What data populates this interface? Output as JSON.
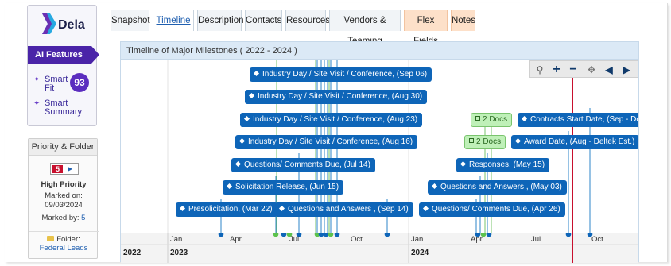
{
  "brand": {
    "logo_text": "Dela",
    "ai_tab": "AI Features",
    "smart_fit_label": "Smart Fit",
    "smart_fit_score": "93",
    "smart_summary_label": "Smart Summary"
  },
  "priority": {
    "header": "Priority & Folder",
    "level": "5",
    "level_text": "High Priority",
    "marked_on_label": "Marked on:",
    "marked_on_date": "09/03/2024",
    "marked_by_label": "Marked by:",
    "marked_by_value": "5",
    "folder_label": "Folder:",
    "folder_name": "Federal Leads"
  },
  "tabs": [
    {
      "label": "Snapshot"
    },
    {
      "label": "Timeline"
    },
    {
      "label": "Description"
    },
    {
      "label": "Contacts"
    },
    {
      "label": "Resources"
    },
    {
      "label": "Vendors & Teaming"
    },
    {
      "label": "Flex Fields"
    },
    {
      "label": "Notes"
    }
  ],
  "panel": {
    "title": "Timeline of Major Milestones ( 2022 - 2024 )"
  },
  "timeline": {
    "milestones": [
      {
        "label": "Industry Day / Site Visit / Conference, (Sep 06)"
      },
      {
        "label": "Industry Day / Site Visit / Conference, (Aug 30)"
      },
      {
        "label": "Industry Day / Site Visit / Conference, (Aug 23)"
      },
      {
        "label": "Industry Day / Site Visit / Conference, (Aug 16)"
      },
      {
        "label": "Questions/ Comments Due, (Jul 14)"
      },
      {
        "label": "Solicitation Release, (Jun 15)"
      },
      {
        "label": "Presolicitation, (Mar 22)"
      },
      {
        "label": "Questions and Answers , (Sep 14)"
      },
      {
        "label": "Contracts Start Date, (Sep - Deltek"
      },
      {
        "label": "Award Date, (Aug - Deltek Est.)"
      },
      {
        "label": "Responses, (May 15)"
      },
      {
        "label": "Questions and Answers , (May 03)"
      },
      {
        "label": "Questions/ Comments Due, (Apr 26)"
      }
    ],
    "docs": [
      {
        "label": "2 Docs"
      },
      {
        "label": "2 Docs"
      }
    ],
    "axis": {
      "months": [
        "Jan",
        "Apr",
        "Jul",
        "Oct",
        "Jan",
        "Apr",
        "Jul",
        "Oct"
      ],
      "years": [
        "2022",
        "2023",
        "2024"
      ]
    }
  },
  "colors": {
    "accent": "#0e65b8",
    "today_line": "#c8102e",
    "brand": "#4a24a8"
  }
}
